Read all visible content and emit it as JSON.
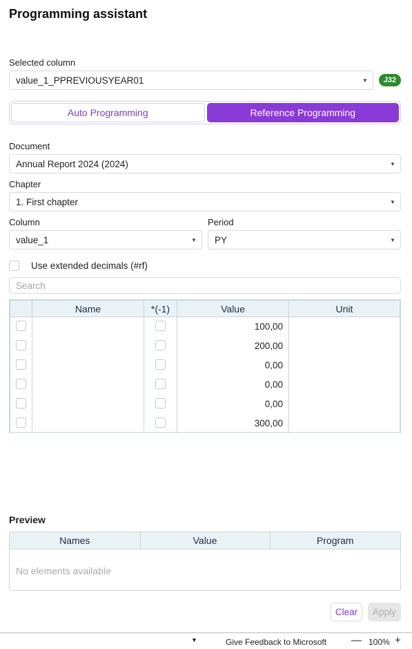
{
  "header": {
    "title": "Programming assistant"
  },
  "selected_column": {
    "label": "Selected column",
    "value": "value_1_PPREVIOUSYEAR01",
    "badge": "J32"
  },
  "mode": {
    "options": [
      "Auto Programming",
      "Reference Programming"
    ],
    "active": "Reference Programming"
  },
  "document": {
    "label": "Document",
    "value": "Annual Report 2024 (2024)"
  },
  "chapter": {
    "label": "Chapter",
    "value": "1. First chapter"
  },
  "column": {
    "label": "Column",
    "value": "value_1"
  },
  "period": {
    "label": "Period",
    "value": "PY"
  },
  "extended_decimals": {
    "label": "Use extended decimals (#rf)",
    "checked": false
  },
  "search": {
    "placeholder": "Search"
  },
  "table": {
    "headers": [
      "",
      "Name",
      "*(-1)",
      "Value",
      "Unit"
    ],
    "rows": [
      {
        "name": "",
        "value": "100,00",
        "unit": ""
      },
      {
        "name": "",
        "value": "200,00",
        "unit": ""
      },
      {
        "name": "",
        "value": "0,00",
        "unit": ""
      },
      {
        "name": "",
        "value": "0,00",
        "unit": ""
      },
      {
        "name": "",
        "value": "0,00",
        "unit": ""
      },
      {
        "name": "",
        "value": "300,00",
        "unit": ""
      }
    ]
  },
  "preview": {
    "title": "Preview",
    "headers": [
      "Names",
      "Value",
      "Program"
    ],
    "empty_text": "No elements available"
  },
  "actions": {
    "clear": "Clear",
    "apply": "Apply"
  },
  "statusbar": {
    "feedback": "Give Feedback to Microsoft",
    "zoom": "100%"
  },
  "colors": {
    "accent": "#8a3ad6",
    "badge": "#2e8b2e",
    "table_header": "#e9f3f5"
  }
}
